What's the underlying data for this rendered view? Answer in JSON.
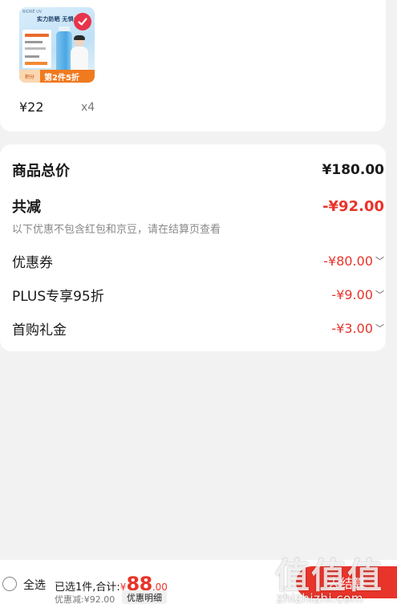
{
  "product": {
    "image": {
      "brand_text": "BIORÉ UV",
      "slogan": "实力防晒 无惧水汗",
      "badge_small": "积分",
      "badge_big": "第2件5折"
    },
    "price": "¥22",
    "quantity": "x4"
  },
  "summary": {
    "total_label": "商品总价",
    "total_value": "¥180.00",
    "discount_label": "共减",
    "discount_value": "-¥92.00",
    "hint": "以下优惠不包含红包和京豆，请在结算页查看",
    "items": [
      {
        "label": "优惠券",
        "value": "-¥80.00"
      },
      {
        "label": "PLUS专享95折",
        "value": "-¥9.00"
      },
      {
        "label": "首购礼金",
        "value": "-¥3.00"
      }
    ]
  },
  "bottom_bar": {
    "select_all": "全选",
    "selected_text": "已选1件,合计:",
    "currency": "¥",
    "total_int": "88",
    "total_dec": ".00",
    "saved_text": "优惠减:¥92.00",
    "detail_button": "优惠明细",
    "checkout_button": "去结算"
  },
  "watermark": {
    "logo": "值值值",
    "url": "zhizhizhi.com"
  },
  "colors": {
    "accent_red": "#e8342a",
    "banner_orange": "#f07a1e",
    "page_bg": "#f2f2f2"
  },
  "icons": [
    "check-icon",
    "chevron-down-icon",
    "radio-icon"
  ]
}
